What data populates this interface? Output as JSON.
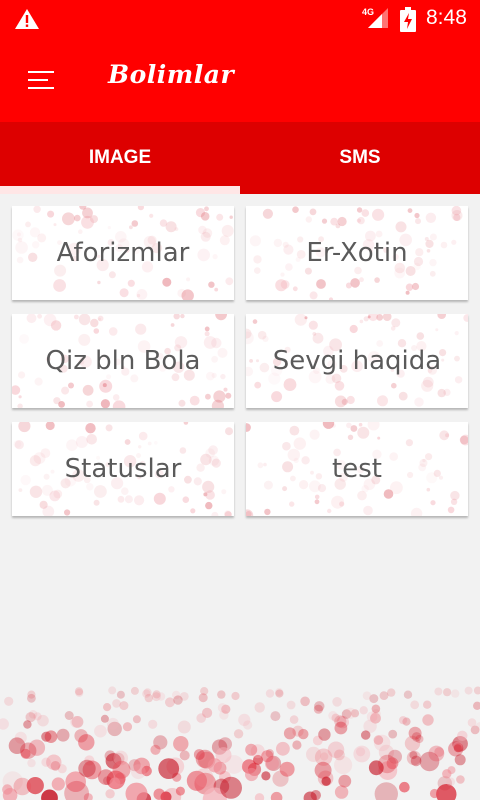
{
  "status_bar": {
    "warning_icon": "warning-icon",
    "network_label": "4G",
    "battery_icon": "battery-charging-icon",
    "time": "8:48"
  },
  "app_bar": {
    "menu_icon": "hamburger-menu-icon",
    "title": "Bolimlar"
  },
  "tabs": [
    {
      "label": "IMAGE",
      "selected": true
    },
    {
      "label": "SMS",
      "selected": false
    }
  ],
  "categories": [
    {
      "label": "Aforizmlar"
    },
    {
      "label": "Er-Xotin"
    },
    {
      "label": "Qiz bln Bola"
    },
    {
      "label": "Sevgi haqida"
    },
    {
      "label": "Statuslar"
    },
    {
      "label": "test"
    }
  ],
  "colors": {
    "primary": "#ff0000",
    "tab_bar": "#dd0000",
    "background": "#f2f2f2",
    "card_text": "#5a5a5a"
  }
}
